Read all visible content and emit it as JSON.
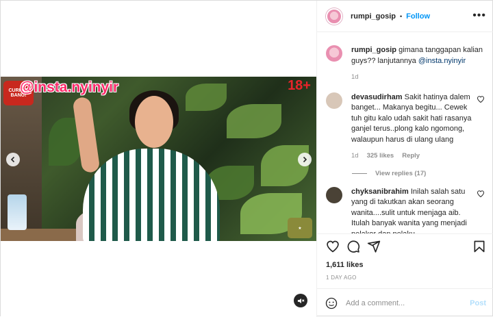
{
  "header": {
    "username": "rumpi_gosip",
    "separator": "•",
    "follow_label": "Follow",
    "more_label": "•••"
  },
  "video": {
    "watermark": "@insta.nyinyir",
    "rating": "18+",
    "logo_text": "CURHAT BANG!",
    "prev_icon": "chevron-left-icon",
    "next_icon": "chevron-right-icon",
    "mute_icon": "speaker-muted-icon"
  },
  "caption": {
    "username": "rumpi_gosip",
    "text": "gimana tanggapan kalian guys?? lanjutannya",
    "mention": "@insta.nyinyir",
    "time": "1d"
  },
  "comments": [
    {
      "username": "devasudirham",
      "text": "Sakit hatinya dalem banget... Makanya begitu... Cewek tuh gitu kalo udah sakit hati rasanya ganjel terus..plong kalo ngomong, walaupun harus di ulang ulang",
      "time": "1d",
      "likes": "325 likes",
      "reply_label": "Reply",
      "view_replies": "View replies (17)",
      "avatar_color": "#d8c7b8"
    },
    {
      "username": "chyksanibrahim",
      "text": "Inilah salah satu yang di takutkan akan seorang wanita....sulit untuk menjaga aib. Itulah banyak wanita yang menjadi pelakor dan pelaku...",
      "avatar_color": "#4a4236"
    }
  ],
  "actions": {
    "like_icon": "heart-icon",
    "comment_icon": "comment-icon",
    "share_icon": "share-icon",
    "save_icon": "bookmark-icon"
  },
  "likes_count": "1,611 likes",
  "post_date": "1 DAY AGO",
  "composer": {
    "emoji_icon": "smiley-icon",
    "placeholder": "Add a comment...",
    "post_label": "Post"
  },
  "colors": {
    "accent": "#0095f6",
    "watermark": "#ff2a6a",
    "rating": "#e8242a",
    "post_disabled": "#b2dffc"
  }
}
